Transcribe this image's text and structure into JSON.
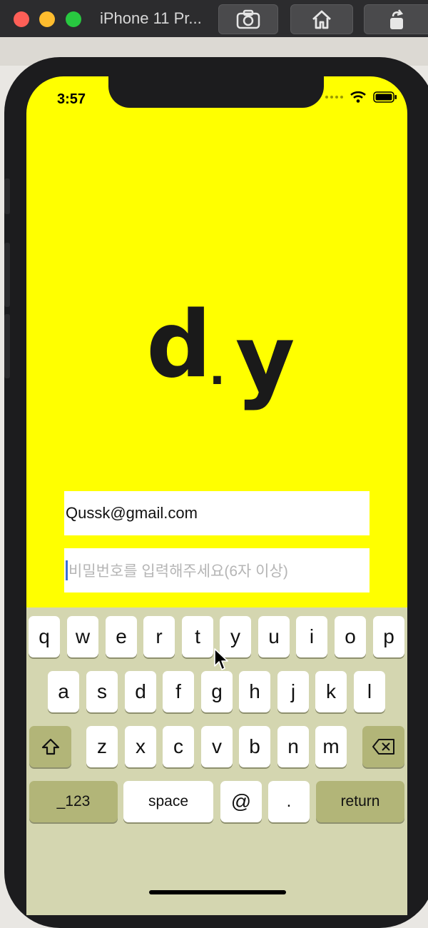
{
  "window": {
    "title": "iPhone 11 Pr..."
  },
  "toolbar": {
    "screenshot_icon": "camera-icon",
    "home_icon": "home-icon",
    "rotate_icon": "rotate-icon"
  },
  "status_bar": {
    "time": "3:57"
  },
  "app": {
    "logo_d": "d",
    "logo_dot": ".",
    "logo_y": "y",
    "email_value": "Qussk@gmail.com",
    "password_placeholder": "비밀번호를 입력해주세요(6자 이상)",
    "background_color": "#ffff00"
  },
  "keyboard": {
    "row1": [
      "q",
      "w",
      "e",
      "r",
      "t",
      "y",
      "u",
      "i",
      "o",
      "p"
    ],
    "row2": [
      "a",
      "s",
      "d",
      "f",
      "g",
      "h",
      "j",
      "k",
      "l"
    ],
    "row3": [
      "z",
      "x",
      "c",
      "v",
      "b",
      "n",
      "m"
    ],
    "numbers_label": "_123",
    "space_label": "space",
    "at_label": "@",
    "period_label": ".",
    "return_label": "return"
  }
}
